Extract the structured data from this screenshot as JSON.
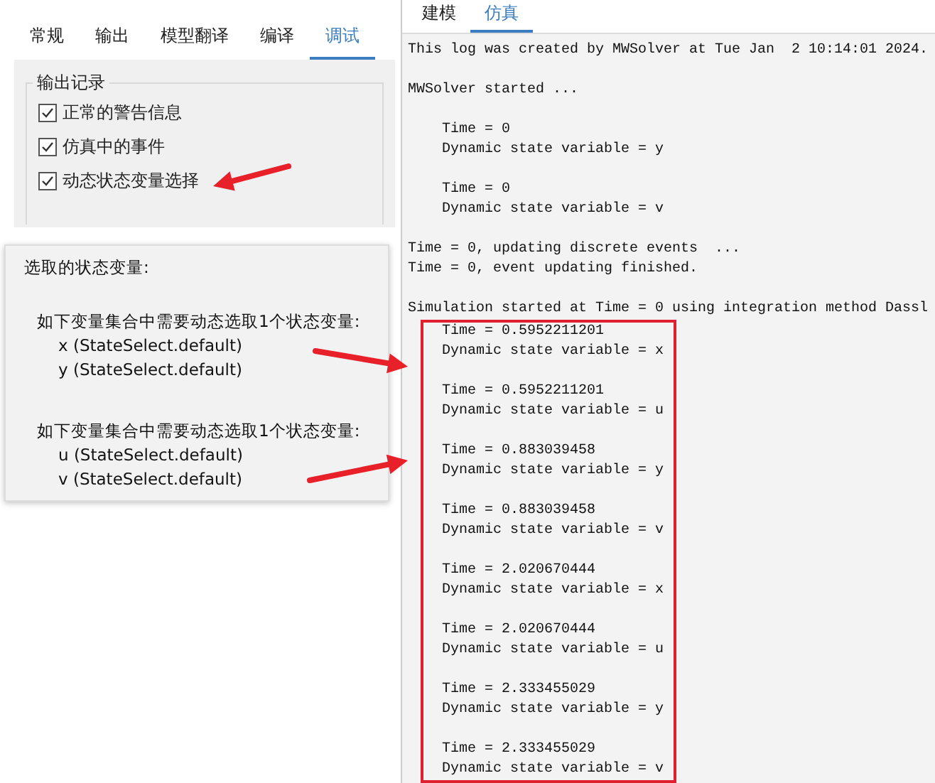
{
  "settings": {
    "tabs": [
      {
        "label": "常规",
        "selected": false
      },
      {
        "label": "输出",
        "selected": false
      },
      {
        "label": "模型翻译",
        "selected": false
      },
      {
        "label": "编译",
        "selected": false
      },
      {
        "label": "调试",
        "selected": true
      }
    ],
    "group": {
      "title": "输出记录",
      "options": [
        {
          "label": "正常的警告信息",
          "checked": true
        },
        {
          "label": "仿真中的事件",
          "checked": true
        },
        {
          "label": "动态状态变量选择",
          "checked": true
        }
      ]
    }
  },
  "note": {
    "title": "选取的状态变量:",
    "groups": [
      {
        "heading": "如下变量集合中需要动态选取1个状态变量:",
        "items": [
          "x (StateSelect.default)",
          "y (StateSelect.default)"
        ]
      },
      {
        "heading": "如下变量集合中需要动态选取1个状态变量:",
        "items": [
          "u (StateSelect.default)",
          "v (StateSelect.default)"
        ]
      }
    ]
  },
  "log_panel": {
    "tabs": [
      {
        "label": "建模",
        "selected": false
      },
      {
        "label": "仿真",
        "selected": true
      }
    ],
    "blocks": [
      {
        "indented": false,
        "lines": [
          "This log was created by MWSolver at Tue Jan  2 10:14:01 2024."
        ]
      },
      {
        "indented": false,
        "lines": [
          "MWSolver started ..."
        ]
      },
      {
        "indented": true,
        "lines": [
          "Time = 0",
          "Dynamic state variable = y"
        ]
      },
      {
        "indented": true,
        "lines": [
          "Time = 0",
          "Dynamic state variable = v"
        ]
      },
      {
        "indented": false,
        "lines": [
          "Time = 0, updating discrete events  ...",
          "Time = 0, event updating finished."
        ]
      },
      {
        "indented": false,
        "lines": [
          "Simulation started at Time = 0 using integration method Dassl"
        ]
      }
    ],
    "highlighted_blocks": [
      {
        "lines": [
          "Time = 0.5952211201",
          "Dynamic state variable = x"
        ]
      },
      {
        "lines": [
          "Time = 0.5952211201",
          "Dynamic state variable = u"
        ]
      },
      {
        "lines": [
          "Time = 0.883039458",
          "Dynamic state variable = y"
        ]
      },
      {
        "lines": [
          "Time = 0.883039458",
          "Dynamic state variable = v"
        ]
      },
      {
        "lines": [
          "Time = 2.020670444",
          "Dynamic state variable = x"
        ]
      },
      {
        "lines": [
          "Time = 2.020670444",
          "Dynamic state variable = u"
        ]
      },
      {
        "lines": [
          "Time = 2.333455029",
          "Dynamic state variable = y"
        ]
      },
      {
        "lines": [
          "Time = 2.333455029",
          "Dynamic state variable = v"
        ]
      }
    ]
  }
}
